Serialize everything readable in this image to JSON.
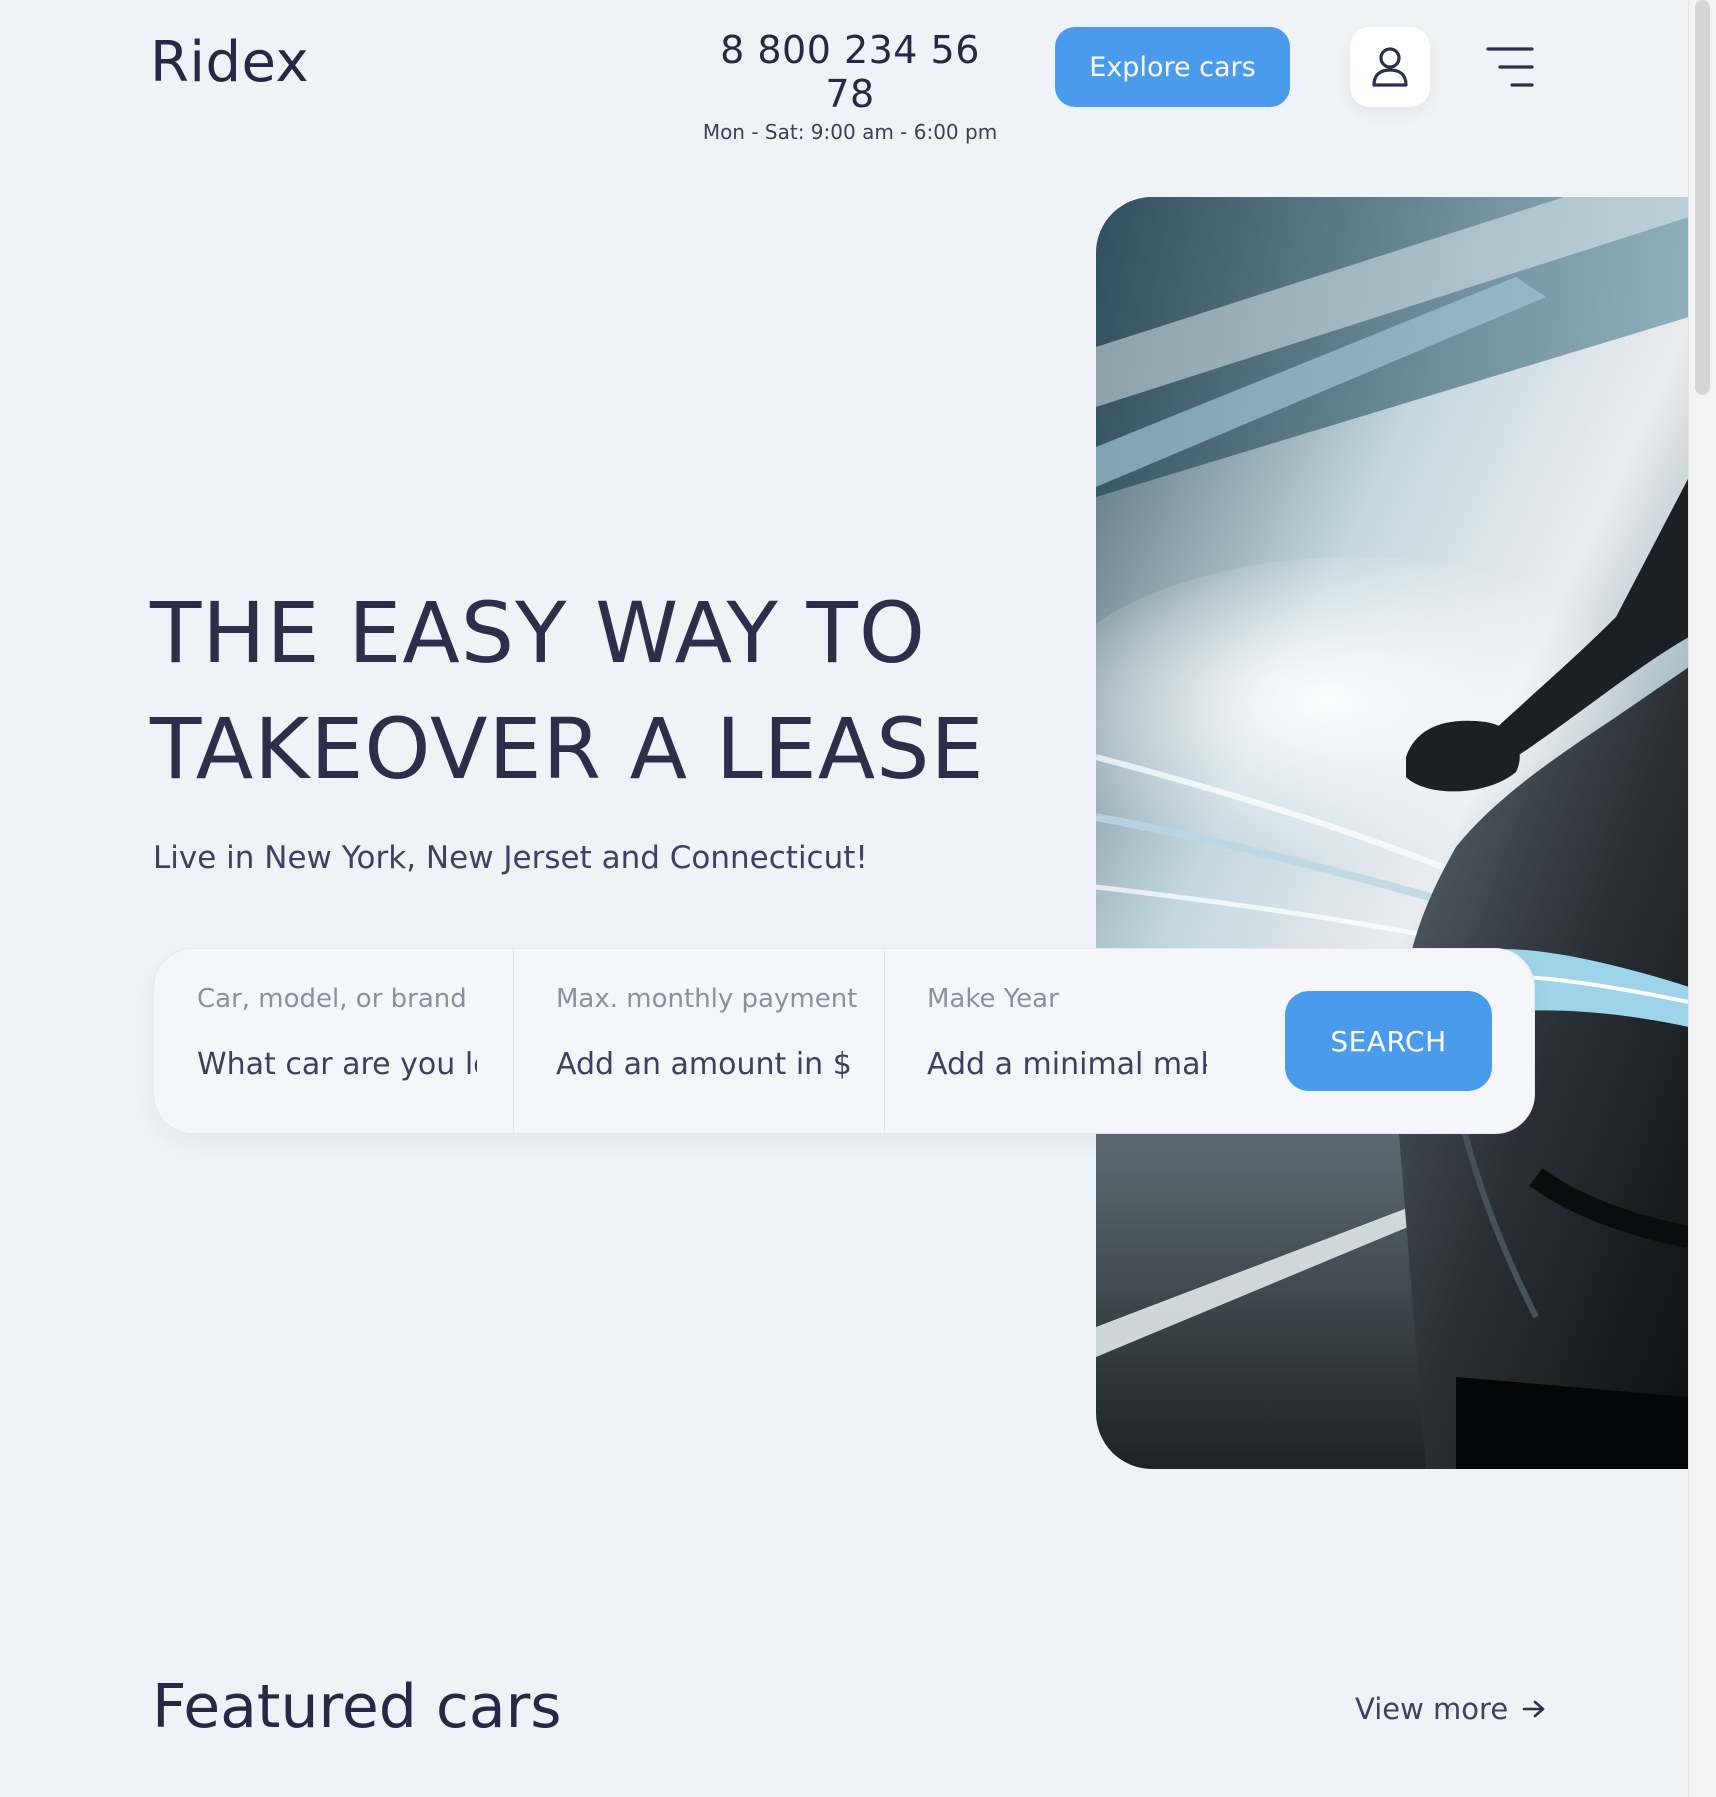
{
  "brand": {
    "logo": "Ridex"
  },
  "header": {
    "phone": "8 800 234 56 78",
    "hours": "Mon - Sat: 9:00 am - 6:00 pm",
    "explore_label": "Explore cars",
    "user_icon": "user-icon",
    "menu_icon": "menu-icon"
  },
  "hero": {
    "title_line1": "THE EASY WAY TO",
    "title_line2": "TAKEOVER A LEASE",
    "subtitle": "Live in New York, New Jerset and Connecticut!"
  },
  "search": {
    "fields": [
      {
        "label": "Car, model, or brand",
        "placeholder": "What car are you looking?"
      },
      {
        "label": "Max. monthly payment",
        "placeholder": "Add an amount in $"
      },
      {
        "label": "Make Year",
        "placeholder": "Add a minimal make year"
      }
    ],
    "button_label": "SEARCH"
  },
  "featured": {
    "title": "Featured cars",
    "view_more": "View more",
    "arrow_icon": "arrow-right-icon"
  },
  "colors": {
    "accent": "#4b9bec",
    "background": "#eff2f7",
    "text_dark": "#262845"
  }
}
